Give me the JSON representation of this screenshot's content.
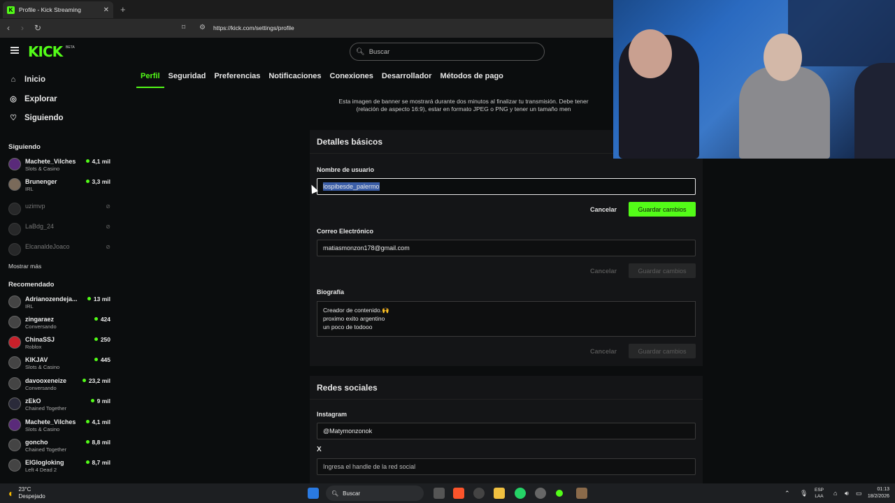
{
  "browser": {
    "tab_title": "Profile - Kick Streaming",
    "url": "https://kick.com/settings/profile"
  },
  "header": {
    "logo": "KICK",
    "beta": "BETA",
    "search_placeholder": "Buscar"
  },
  "settings_tabs": [
    "Perfil",
    "Seguridad",
    "Preferencias",
    "Notificaciones",
    "Conexiones",
    "Desarrollador",
    "Métodos de pago"
  ],
  "sidebar": {
    "nav": [
      "Inicio",
      "Explorar",
      "Siguiendo"
    ],
    "following_title": "Siguiendo",
    "following": [
      {
        "name": "Machete_Vilches",
        "category": "Slots & Casino",
        "viewers": "4,1 mil",
        "live": true
      },
      {
        "name": "Brunenger",
        "category": "IRL",
        "viewers": "3,3 mil",
        "live": true
      },
      {
        "name": "uzimvp",
        "category": "",
        "viewers": "",
        "live": false
      },
      {
        "name": "LaBdg_24",
        "category": "",
        "viewers": "",
        "live": false
      },
      {
        "name": "ElcanaldeJoaco",
        "category": "",
        "viewers": "",
        "live": false
      }
    ],
    "show_more": "Mostrar más",
    "recommended_title": "Recomendado",
    "recommended": [
      {
        "name": "Adrianozendeja...",
        "category": "IRL",
        "viewers": "13 mil"
      },
      {
        "name": "zingaraez",
        "category": "Conversando",
        "viewers": "424"
      },
      {
        "name": "ChinaSSJ",
        "category": "Roblox",
        "viewers": "250"
      },
      {
        "name": "KIKJAV",
        "category": "Slots & Casino",
        "viewers": "445"
      },
      {
        "name": "davooxeneize",
        "category": "Conversando",
        "viewers": "23,2 mil"
      },
      {
        "name": "zEkO",
        "category": "Chained Together",
        "viewers": "9 mil"
      },
      {
        "name": "Machete_Vilches",
        "category": "Slots & Casino",
        "viewers": "4,1 mil"
      },
      {
        "name": "goncho",
        "category": "Chained Together",
        "viewers": "8,8 mil"
      },
      {
        "name": "ElGlogloking",
        "category": "Left 4 Dead 2",
        "viewers": "8,7 mil"
      }
    ]
  },
  "banner": {
    "text_line1": "Esta imagen de banner se mostrará durante dos minutos al finalizar tu transmisión. Debe tener",
    "text_line2": "(relación de aspecto 16:9), estar en formato JPEG o PNG y tener un tamaño men"
  },
  "basic": {
    "title": "Detalles básicos",
    "username_label": "Nombre de usuario",
    "username_value": "lospibesde_palermo",
    "email_label": "Correo Electrónico",
    "email_value": "matiasmonzon178@gmail.com",
    "bio_label": "Biografía",
    "bio_lines": [
      "Creador de contenido.🙌",
      "proximo exito argentino",
      "un poco de todooo"
    ],
    "cancel": "Cancelar",
    "save": "Guardar cambios"
  },
  "social": {
    "title": "Redes sociales",
    "instagram_label": "Instagram",
    "instagram_value": "@Matymonzonok",
    "x_label": "X",
    "x_placeholder": "Ingresa el handle de la red social"
  },
  "taskbar": {
    "weather_temp": "23°C",
    "weather_desc": "Despejado",
    "search": "Buscar",
    "lang1": "ESP",
    "lang2": "LAA",
    "time": "01:13",
    "date": "18/2/2026"
  },
  "colors": {
    "accent": "#53fc18",
    "background": "#0b0d0e",
    "card": "#141517"
  }
}
